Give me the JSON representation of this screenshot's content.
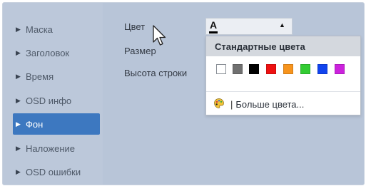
{
  "sidebar": {
    "items": [
      {
        "label": "Маска",
        "active": false
      },
      {
        "label": "Заголовок",
        "active": false
      },
      {
        "label": "Время",
        "active": false
      },
      {
        "label": "OSD инфо",
        "active": false
      },
      {
        "label": "Фон",
        "active": true
      },
      {
        "label": "Наложение",
        "active": false
      },
      {
        "label": "OSD ошибки",
        "active": false
      }
    ]
  },
  "form": {
    "color_label": "Цвет",
    "size_label": "Размер",
    "line_height_label": "Высота строки"
  },
  "color_select": {
    "letter": "A",
    "selected_color": "#000000",
    "icon": "caret-up-icon"
  },
  "palette": {
    "header": "Стандартные цвета",
    "swatches": [
      "#ffffff",
      "#707070",
      "#000000",
      "#ee1111",
      "#f7941d",
      "#33cc33",
      "#1144ee",
      "#cc22dd"
    ],
    "more_label": "Больше цвета...",
    "more_separator": "|",
    "more_icon": "paint-palette-icon"
  },
  "colors": {
    "active_item": "#3d78c0",
    "background": "#b8c5d8"
  }
}
